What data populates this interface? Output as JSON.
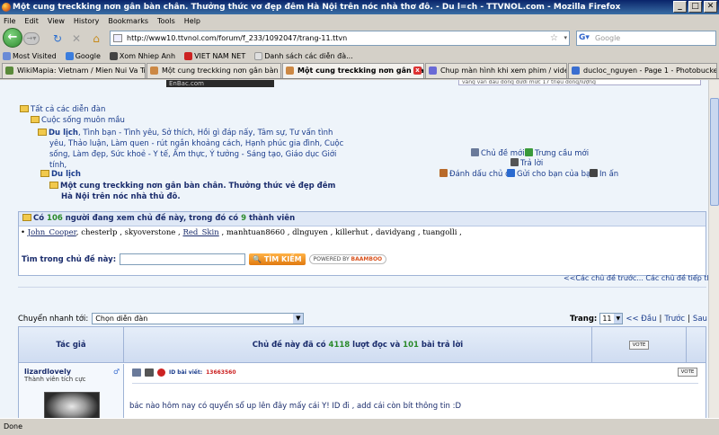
{
  "window": {
    "title": "Một cung treckking nơn gân bàn chân. Thưởng thức vơ đẹp đêm Hà Nội trên nóc nhà thơ đô. - Du l=ch - TTVNOL.com - Mozilla Firefox",
    "minimize": "_",
    "maximize": "□",
    "close": "✕"
  },
  "menu": [
    "File",
    "Edit",
    "View",
    "History",
    "Bookmarks",
    "Tools",
    "Help"
  ],
  "navbar": {
    "url": "http://www10.ttvnol.com/forum/f_233/1092047/trang-11.ttvn",
    "search_placeholder": "Google"
  },
  "bookmarks": [
    {
      "label": "Most Visited",
      "color": "#6a8bd6"
    },
    {
      "label": "Google",
      "color": "#3b7ddd"
    },
    {
      "label": "Xom Nhiep Anh",
      "color": "#444444"
    },
    {
      "label": "VIET NAM NET",
      "color": "#cc2222"
    },
    {
      "label": "Danh sách các diễn đà...",
      "color": "#e0e0e0"
    }
  ],
  "tabs": [
    {
      "label": "WikiMapia: Vietnam / Mien Nui Va Trung...",
      "active": false
    },
    {
      "label": "Một cung treckking nơn gân bàn chân...",
      "active": false
    },
    {
      "label": "Một cung treckking nơn gân bàn ...",
      "active": true
    },
    {
      "label": "Chup màn hình khi xem phim / video bằ...",
      "active": false
    },
    {
      "label": "ducloc_nguyen - Page 1 - Photobucket ...",
      "active": false
    }
  ],
  "content": {
    "banner": "EnBac.com",
    "topbox": "vàng vẫn dẫu dồng dưới mức 17 triệu đồng/lượng",
    "breadcrumb": {
      "root": "Tất cả các diễn đàn",
      "level1": "Cuộc sống muôn mầu",
      "forum_name": "Du lịch",
      "forum_desc": ", Tình bạn - Tình yêu, Sở thích, Hồi gì đáp nấy, Tâm sự, Tư vấn tình yêu, Thảo luận, Làm quen - rút ngắn khoảng cách, Hạnh phúc gia đình, Cuộc sống, Làm đẹp, Sức khoẻ - Y tế, Ẩm thực, Ý tưởng - Sáng tạo, Giáo dục Giới tính,",
      "current_forum": "Du lịch",
      "topic": "Một cung treckking nơn gân bàn chân. Thưởng thức vẻ đẹp đêm Hà Nội trên nóc nhà thủ đô."
    },
    "actions": {
      "new_topic": "Chủ đề mới",
      "poll": "Trưng cầu mới",
      "reply": "Trả lời",
      "bookmark": "Đánh dấu chủ đề",
      "send_friend": "Gửi cho bạn của bạn",
      "print": "In ấn"
    },
    "viewers": {
      "prefix": "Có ",
      "count": "106",
      "middle": " người đang xem chủ đề này, trong đó có ",
      "members": "9",
      "suffix": " thành viên",
      "users": [
        "John_Cooper",
        "chesterlp",
        "skyoverstone",
        "Red_Skin",
        "manhtuan8660",
        "dlnguyen",
        "killerhut",
        "davidyang",
        "tuangolli"
      ]
    },
    "search": {
      "label": "Tìm trong chủ đề này:",
      "button": "TÌM KIẾM",
      "powered_prefix": "POWERED BY ",
      "powered_brand": "BAAMBOO"
    },
    "prevnext": "<<Các chủ đề trước... Các chủ đề tiếp theo>>",
    "quick_jump": {
      "label": "Chuyển nhanh tới:",
      "value": "Chọn diễn đàn"
    },
    "pager": {
      "label": "Trang:",
      "value": "11",
      "first": "<< Đầu",
      "prev": "Trước",
      "next": "Sau",
      "sep": "|"
    },
    "post_header": {
      "author_col": "Tác giả",
      "stats_prefix": "Chủ đề này đã có ",
      "views": "4118",
      "stats_mid": " lượt đọc và ",
      "replies": "101",
      "stats_suffix": " bài trả lời",
      "vote": "VOTE"
    },
    "post": {
      "author": "lizardlovely",
      "rank": "Thành viên tích cực",
      "gender_icon": "♂",
      "id_label": "ID bài viết:",
      "id_value": "13663560",
      "vote": "VOTE",
      "message": "bác nào hôm nay có quyển sổ up lên đây mấy cái Y! ID đi , add cái còn bít thông tin :D"
    }
  },
  "status": "Done"
}
